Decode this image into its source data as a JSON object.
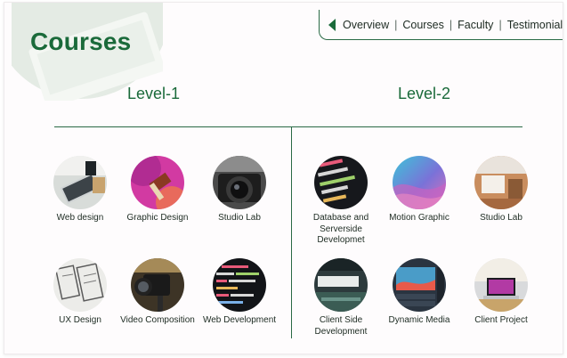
{
  "page": {
    "title": "Courses"
  },
  "nav": {
    "items": [
      "Overview",
      "Courses",
      "Faculty",
      "Testimonials"
    ],
    "prev_icon": "triangle-left",
    "next_icon": "triangle-right"
  },
  "levels": [
    {
      "heading": "Level-1",
      "courses": [
        {
          "label": "Web design",
          "icon": "laptop-desk-photo"
        },
        {
          "label": "Graphic Design",
          "icon": "paintbrush-photo"
        },
        {
          "label": "Studio Lab",
          "icon": "camera-photo"
        },
        {
          "label": "UX Design",
          "icon": "wireframe-sketch-photo"
        },
        {
          "label": "Video Composition",
          "icon": "video-camera-photo"
        },
        {
          "label": "Web Development",
          "icon": "html-code-photo"
        }
      ]
    },
    {
      "heading": "Level-2",
      "courses": [
        {
          "label": "Database and Serverside Developmet",
          "icon": "php-code-photo"
        },
        {
          "label": "Motion Graphic",
          "icon": "gradient-waves-photo"
        },
        {
          "label": "Studio Lab",
          "icon": "desk-wood-photo"
        },
        {
          "label": "Client Side Development",
          "icon": "client-ui-photo"
        },
        {
          "label": "Dynamic Media",
          "icon": "editing-screen-photo"
        },
        {
          "label": "Client Project",
          "icon": "laptop-desk-photo"
        }
      ]
    }
  ],
  "colors": {
    "brand_green": "#1a6a3a",
    "line_green": "#2a6a45",
    "text": "#1d2b22"
  }
}
